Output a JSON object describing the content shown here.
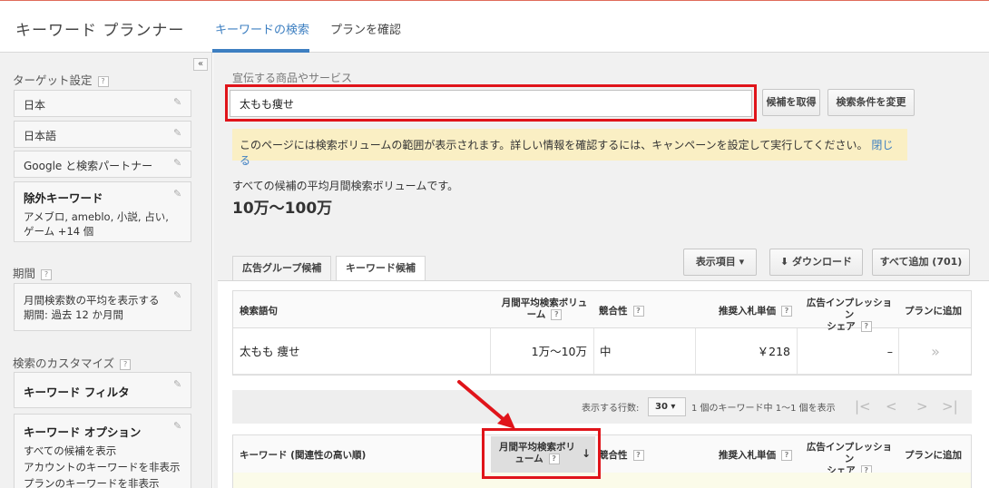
{
  "header": {
    "app_title": "キーワード プランナー",
    "tabs": [
      {
        "label": "キーワードの検索",
        "active": true
      },
      {
        "label": "プランを確認",
        "active": false
      }
    ]
  },
  "sidebar": {
    "collapse_label": "«",
    "targeting": {
      "heading": "ターゲット設定",
      "items": [
        "日本",
        "日本語",
        "Google と検索パートナー"
      ],
      "negative": {
        "title": "除外キーワード",
        "detail": "アメブロ, ameblo, 小説, 占い, ゲーム +14 個"
      }
    },
    "period": {
      "heading": "期間",
      "box_line1": "月間検索数の平均を表示する",
      "box_line2": "期間: 過去 12 か月間"
    },
    "customize": {
      "heading": "検索のカスタマイズ",
      "filter_title": "キーワード フィルタ",
      "options_title": "キーワード オプション",
      "options_lines": [
        "すべての候補を表示",
        "アカウントのキーワードを非表示",
        "プランのキーワードを非表示"
      ]
    },
    "help_mark": "?"
  },
  "main": {
    "product_label": "宣伝する商品やサービス",
    "keyword_input_value": "太もも痩せ",
    "get_ideas_button": "候補を取得",
    "modify_search_button": "検索条件を変更",
    "notice_text": "このページには検索ボリュームの範囲が表示されます。詳しい情報を確認するには、キャンペーンを設定して実行してください。",
    "notice_close": "閉じる",
    "avg_text": "すべての候補の平均月間検索ボリュームです。",
    "avg_value": "10万～100万",
    "result_tabs": [
      {
        "label": "広告グループ候補",
        "active": false
      },
      {
        "label": "キーワード候補",
        "active": true
      }
    ],
    "columns_button": "表示項目",
    "download_button": "ダウンロード",
    "add_all_button": "すべて追加 (701)",
    "search_table": {
      "headers": {
        "term": "検索語句",
        "volume": "月間平均検索ボリューム",
        "competition": "競合性",
        "bid": "推奨入札単価",
        "share_line1": "広告インプレッション",
        "share_line2": "シェア",
        "add": "プランに追加"
      },
      "rows": [
        {
          "term": "太もも 痩せ",
          "volume": "1万～10万",
          "competition": "中",
          "bid": "￥218",
          "share": "–",
          "add": "»"
        }
      ]
    },
    "pager": {
      "rows_label": "表示する行数:",
      "rows_value": "30",
      "range_text": "1 個のキーワード中 1～1 個を表示"
    },
    "keyword_table": {
      "headers": {
        "keyword": "キーワード (関連性の高い順)",
        "volume": "月間平均検索ボリューム",
        "competition": "競合性",
        "bid": "推奨入札単価",
        "share_line1": "広告インプレッション",
        "share_line2": "シェア",
        "add": "プランに追加"
      }
    }
  },
  "colors": {
    "accent": "#3d7fc1",
    "highlight_red": "#e0141a",
    "notice_bg": "#faefc4"
  }
}
